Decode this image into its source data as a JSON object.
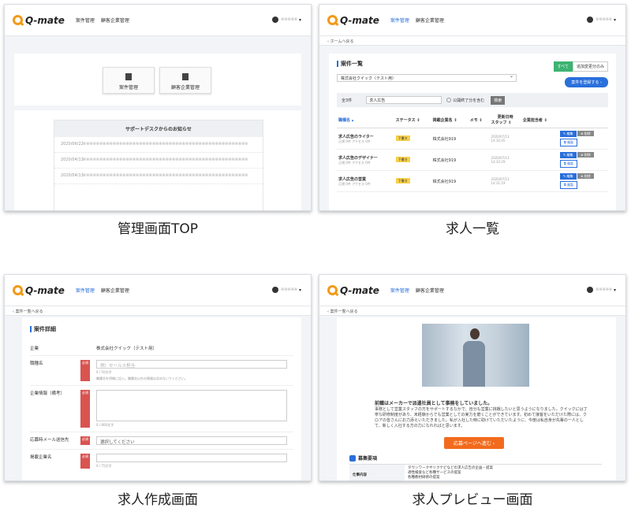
{
  "app": {
    "logo": "Q-mate",
    "nav_jobs": "案件管理",
    "nav_clients": "顧客企業管理",
    "user": "※※※※※"
  },
  "panel1": {
    "caption": "管理画面TOP",
    "btn_jobs": "案件管理",
    "btn_clients": "顧客企業管理",
    "notice_title": "サポートデスクからのお知らせ",
    "notices": [
      {
        "date": "2020/06/22",
        "text": "※※※※※※※※※※※※※※※※※※※※※※※※※※※※※※※※※※※※※※※※※※※※※※※※※※"
      },
      {
        "date": "2020/04/13",
        "text": "※※※※※※※※※※※※※※※※※※※※※※※※※※※※※※※※※※※※※※※※※※※※※※※※※※"
      },
      {
        "date": "2020/04/13",
        "text": "※※※※※※※※※※※※※※※※※※※※※※※※※※※※※※※※※※※※※※※※※※※※※※※※※※"
      }
    ]
  },
  "panel2": {
    "caption": "求人一覧",
    "breadcrumb": "‹ ホームへ戻る",
    "title": "案件一覧",
    "toggle_all": "すべて",
    "toggle_recent": "追加変更分のみ",
    "company_select": "株式会社クイック（テスト用）",
    "register_btn": "案件を登録する ›",
    "count": "全3件",
    "search_value": "求人広告",
    "include_private": "公開終了分を含む",
    "search_btn": "検索",
    "cols": {
      "title": "職種名 ▴",
      "status": "ステータス ⇕",
      "client": "掲載企業名 ⇕",
      "memo": "メモ ⇕",
      "updated": "更新日時",
      "staff": "スタッフ ⇕",
      "company_staff": "企業担当者 ⇕"
    },
    "rows": [
      {
        "title": "求人広告のライター",
        "sub": "正規 0件 アクセス 0件",
        "status": "下書き",
        "client": "株式会社919",
        "date": "2020/07/13",
        "time": "14:32:45"
      },
      {
        "title": "求人広告のデザイナー",
        "sub": "正規 0件 アクセス 0件",
        "status": "下書き",
        "client": "株式会社919",
        "date": "2020/07/13",
        "time": "14:32:29"
      },
      {
        "title": "求人広告の営業",
        "sub": "正規 0件 アクセス 0件",
        "status": "下書き",
        "client": "株式会社919",
        "date": "2020/07/13",
        "time": "14:31:19"
      }
    ],
    "edit_btn": "✎ 編集",
    "copy_btn": "⧉ 複製",
    "delete_btn": "⊗ 削除"
  },
  "panel3": {
    "caption": "求人作成画面",
    "breadcrumb": "‹ 案件一覧へ戻る",
    "title": "案件詳細",
    "required": "必須",
    "f_company": "企業",
    "company_value": "株式会社クイック（テスト用）",
    "f_job": "職種名",
    "job_placeholder": "例）セールス担当",
    "job_help1": "0 / 50文字",
    "job_help2": "職種名を明確に記入。職種名以外の情報は含めないでください。",
    "f_memo": "企業情報（備考）",
    "memo_help": "0 / 800文字",
    "f_mail": "応募時メール送信先",
    "mail_placeholder": "選択してください",
    "f_client": "掲載企業名",
    "client_help": "0 / 75文字"
  },
  "panel4": {
    "caption": "求人プレビュー画面",
    "breadcrumb": "‹ 案件一覧へ戻る",
    "heading": "前職はメーカーで派遣社員として事務をしていました。",
    "body": "事務として営業スタッフの方をサポートするなかで、自分も営業に挑戦したいと思うようになりました。クイックには丁寧な研修制度があり、未経験からでも営業としての実力を磨くことができています。初めて接客をいただけた際には、クロアの皆さんにお力添えいただきました。私が入社した時に助けていただいたように、今度は私自身が先輩の一人として、新しく入社する方の力になれればと思います。",
    "apply_btn": "応募ページへ進む ›",
    "section": "募集要項",
    "row_label": "仕事内容",
    "row_value1": "タウンワークやリクナビなどの求人広告の企画・提案",
    "row_value2": "適性検査など各種サービスの提案",
    "row_value3": "各種教材研修の提案"
  }
}
